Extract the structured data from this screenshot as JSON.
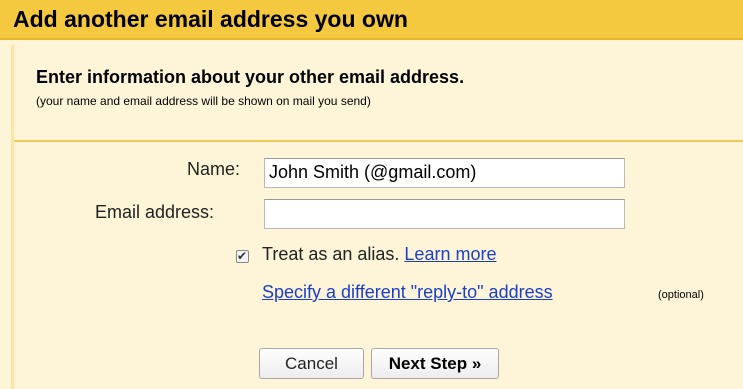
{
  "header": {
    "title": "Add another email address you own"
  },
  "intro": {
    "title": "Enter information about your other email address.",
    "subtitle": "(your name and email address will be shown on mail you send)"
  },
  "form": {
    "name_label": "Name:",
    "name_value": "John Smith (@gmail.com)",
    "email_label": "Email address:",
    "email_value": "",
    "alias_checked": true,
    "alias_label": "Treat as an alias.",
    "learn_more_link": "Learn more",
    "reply_to_link": "Specify a different \"reply-to\" address",
    "optional_label": "(optional)"
  },
  "buttons": {
    "cancel_label": "Cancel",
    "next_label": "Next Step »"
  }
}
